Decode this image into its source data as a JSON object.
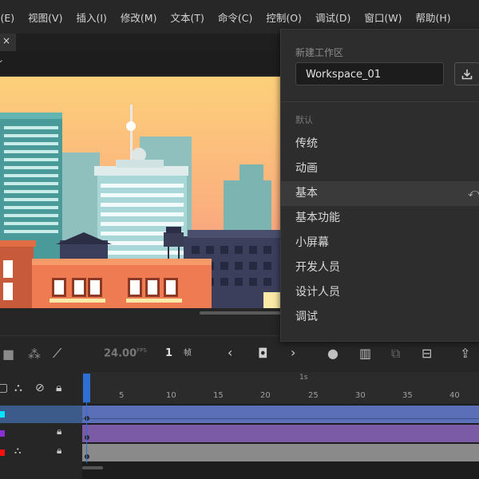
{
  "menu": [
    "辑(E)",
    "视图(V)",
    "插入(I)",
    "修改(M)",
    "文本(T)",
    "命令(C)",
    "控制(O)",
    "调试(D)",
    "窗口(W)",
    "帮助(H)"
  ],
  "doc_tab": {
    "close": "×"
  },
  "timeline": {
    "fps_value": "24.00",
    "fps_unit": "FPS",
    "current_frame": "1",
    "frame_unit": "帧",
    "ruler_label_seconds": "1s",
    "ruler_numbers": [
      "5",
      "10",
      "15",
      "20",
      "25",
      "30",
      "35",
      "40"
    ]
  },
  "layers": [
    {
      "color": "#00e5ff",
      "track_color": "#5b6fb8",
      "selected": true
    },
    {
      "color": "#8b2fd6",
      "track_color": "#7b5aa6",
      "locked": true
    },
    {
      "color": "#ff1010",
      "track_color": "#8a8a8a",
      "locked": true
    }
  ],
  "workspace_panel": {
    "new_label": "新建工作区",
    "name_value": "Workspace_01",
    "section_label": "默认",
    "items": [
      "传统",
      "动画",
      "基本",
      "基本功能",
      "小屏幕",
      "开发人员",
      "设计人员",
      "调试"
    ],
    "active_item": "基本"
  }
}
